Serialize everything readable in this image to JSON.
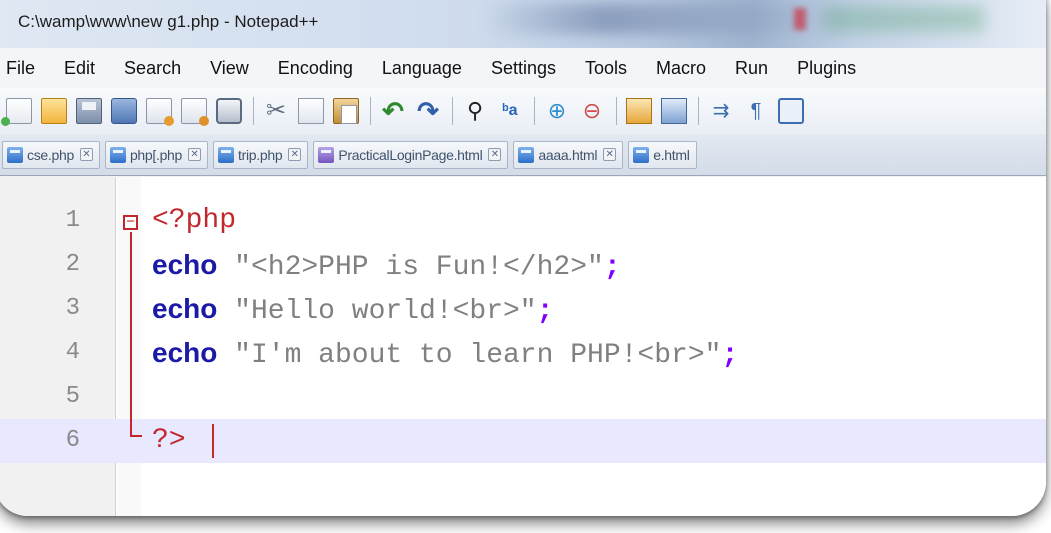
{
  "window": {
    "title": "C:\\wamp\\www\\new g1.php - Notepad++"
  },
  "menu": [
    "File",
    "Edit",
    "Search",
    "View",
    "Encoding",
    "Language",
    "Settings",
    "Tools",
    "Macro",
    "Run",
    "Plugins"
  ],
  "toolbar_icons": [
    "new-file-icon",
    "open-file-icon",
    "save-icon",
    "save-all-icon",
    "close-icon",
    "close-all-icon",
    "print-icon",
    "cut-icon",
    "copy-icon",
    "paste-icon",
    "undo-icon",
    "redo-icon",
    "find-icon",
    "replace-icon",
    "zoom-in-icon",
    "zoom-out-icon",
    "sync-vertical-icon",
    "sync-horizontal-icon",
    "word-wrap-icon",
    "show-all-chars-icon",
    "indent-guide-icon"
  ],
  "tabs": [
    {
      "label": "cse.php"
    },
    {
      "label": "php[.php"
    },
    {
      "label": "trip.php"
    },
    {
      "label": "PracticalLoginPage.html"
    },
    {
      "label": "aaaa.html"
    },
    {
      "label": "e.html"
    }
  ],
  "editor": {
    "current_line": 6,
    "lines": [
      {
        "num": "1",
        "tag": "<?php"
      },
      {
        "num": "2",
        "kw": "echo",
        "str": " \"<h2>PHP is Fun!</h2>\"",
        "semi": ";"
      },
      {
        "num": "3",
        "kw": "echo",
        "str": " \"Hello world!<br>\"",
        "semi": ";"
      },
      {
        "num": "4",
        "kw": "echo",
        "str": " \"I'm about to learn PHP!<br>\"",
        "semi": ";"
      },
      {
        "num": "5"
      },
      {
        "num": "6",
        "tag": "?>"
      }
    ]
  },
  "colors": {
    "keyword": "#1a1aa6",
    "string": "#808080",
    "php_tag": "#c0282d",
    "current_line_bg": "#e8e8ff"
  }
}
